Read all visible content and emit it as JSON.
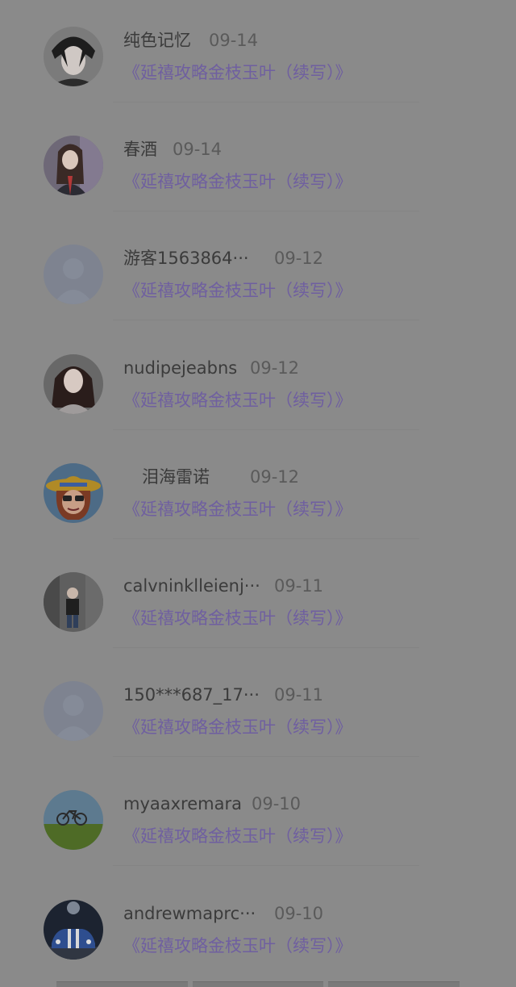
{
  "colors": {
    "overlay_background": "#8a8a8a",
    "name_text": "#3b3b3b",
    "date_text": "#5a5a5a",
    "title_link": "#6f5fa0"
  },
  "items": [
    {
      "name": "纯色记忆",
      "date": "09-14",
      "title": "《延禧攻略金枝玉叶（续写）》",
      "avatar": "anime-boy-icon"
    },
    {
      "name": "春酒",
      "date": "09-14",
      "title": "《延禧攻略金枝玉叶（续写）》",
      "avatar": "girl-photo-icon"
    },
    {
      "name": "游客1563864···",
      "date": "09-12",
      "title": "《延禧攻略金枝玉叶（续写）》",
      "avatar": "default-user-icon"
    },
    {
      "name": "nudipejeabns",
      "date": "09-12",
      "title": "《延禧攻略金枝玉叶（续写）》",
      "avatar": "woman-portrait-icon"
    },
    {
      "name": "泪海雷诺",
      "date": "09-12",
      "title": "《延禧攻略金枝玉叶（续写）》",
      "avatar": "cartoon-hat-icon"
    },
    {
      "name": "calvninklleienj···",
      "date": "09-11",
      "title": "《延禧攻略金枝玉叶（续写）》",
      "avatar": "man-street-icon"
    },
    {
      "name": "150***687_17···",
      "date": "09-11",
      "title": "《延禧攻略金枝玉叶（续写）》",
      "avatar": "default-user-icon"
    },
    {
      "name": "myaaxremara",
      "date": "09-10",
      "title": "《延禧攻略金枝玉叶（续写）》",
      "avatar": "bicycle-field-icon"
    },
    {
      "name": "andrewmaprc···",
      "date": "09-10",
      "title": "《延禧攻略金枝玉叶（续写）》",
      "avatar": "blue-car-icon"
    }
  ]
}
